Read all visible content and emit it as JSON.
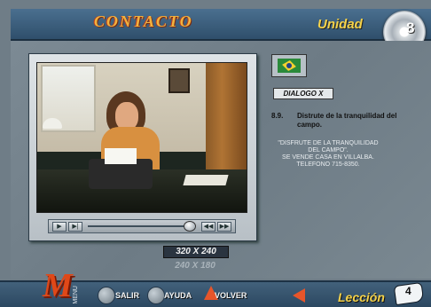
{
  "header": {
    "logo_text": "CONTACTO",
    "unidad_label": "Unidad",
    "unidad_number": "8"
  },
  "video": {
    "controls": {
      "play_icon": "play-icon",
      "step_icon": "step-forward-icon",
      "rewind_icon": "rewind-icon",
      "forward_icon": "forward-icon"
    },
    "resolutions": [
      "320 X 240",
      "240 X 180"
    ],
    "selected_resolution": "320 X 240"
  },
  "dialog": {
    "label": "DIALOGO",
    "close_symbol": "X",
    "sentence_number": "8.9.",
    "sentence_text": "Distrute de la tranquilidad del campo.",
    "quote_lines": [
      "\"DISFRUTE DE LA TRANQUILIDAD",
      "DEL CAMPO\".",
      "SE VENDE CASA EN VILLALBA.",
      "TELEFONO 715-8350."
    ]
  },
  "bottom_nav": {
    "menu_label": "MENU",
    "salir_label": "SALIR",
    "ayuda_label": "AYUDA",
    "volver_label": "VOLVER",
    "leccion_label": "Lección",
    "leccion_number": "4"
  },
  "colors": {
    "accent": "#f4d24a",
    "brand_orange": "#e04818",
    "panel_blue": "#2f4f6b"
  }
}
